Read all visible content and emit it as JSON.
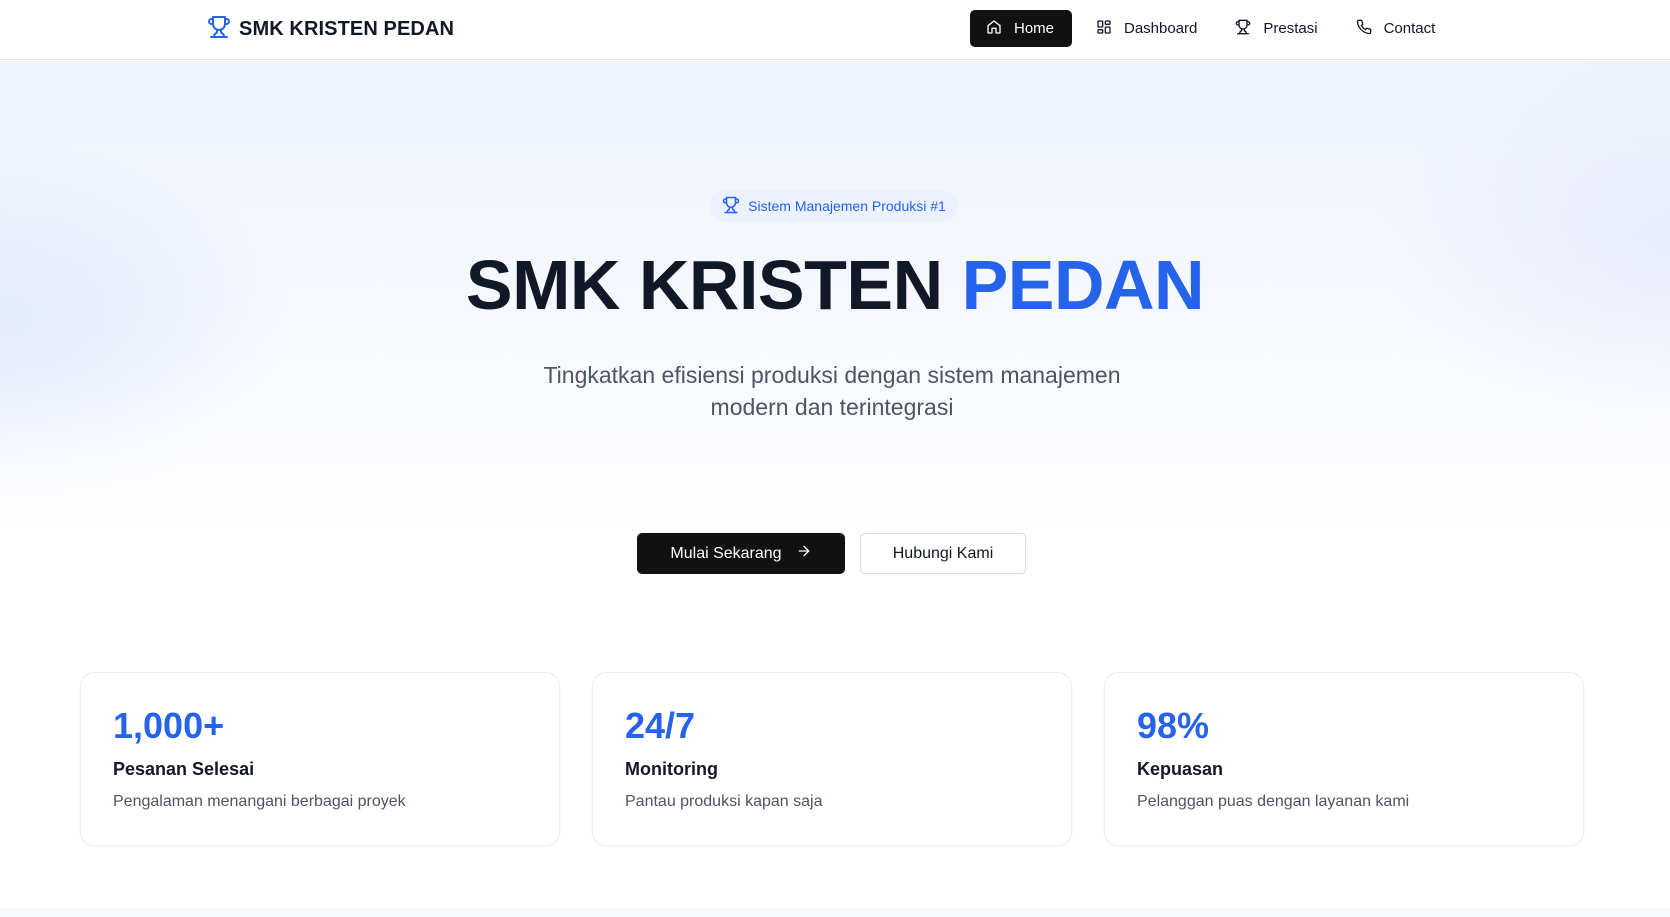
{
  "brand": {
    "name": "SMK KRISTEN PEDAN",
    "icon": "trophy-icon"
  },
  "nav": {
    "items": [
      {
        "label": "Home",
        "icon": "home-icon",
        "active": true
      },
      {
        "label": "Dashboard",
        "icon": "grid-icon",
        "active": false
      },
      {
        "label": "Prestasi",
        "icon": "trophy-icon",
        "active": false
      },
      {
        "label": "Contact",
        "icon": "phone-icon",
        "active": false
      }
    ]
  },
  "hero": {
    "badge": "Sistem Manajemen Produksi #1",
    "title_main": "SMK KRISTEN",
    "title_accent": "PEDAN",
    "subtitle": "Tingkatkan efisiensi produksi dengan sistem manajemen modern dan terintegrasi",
    "primary_button": "Mulai Sekarang",
    "secondary_button": "Hubungi Kami"
  },
  "stats": [
    {
      "value": "1,000+",
      "label": "Pesanan Selesai",
      "description": "Pengalaman menangani berbagai proyek"
    },
    {
      "value": "24/7",
      "label": "Monitoring",
      "description": "Pantau produksi kapan saja"
    },
    {
      "value": "98%",
      "label": "Kepuasan",
      "description": "Pelanggan puas dengan layanan kami"
    }
  ],
  "colors": {
    "accent": "#2563eb",
    "dark": "#111111",
    "text": "#111827",
    "muted": "#4b5563"
  }
}
